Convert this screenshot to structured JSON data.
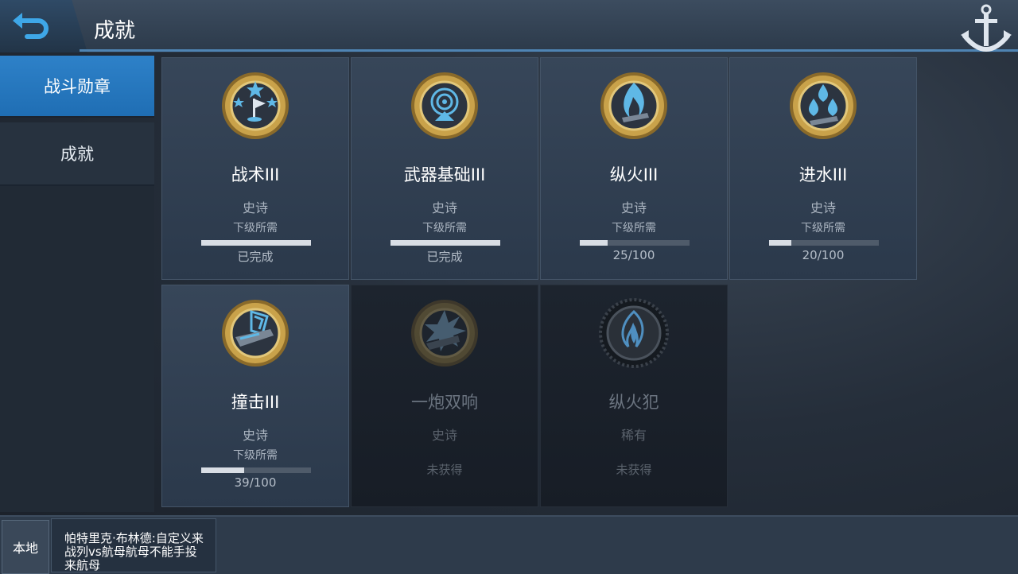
{
  "header": {
    "title": "成就"
  },
  "sidebar": {
    "items": [
      {
        "label": "战斗勋章"
      },
      {
        "label": "成就"
      }
    ]
  },
  "cards": [
    {
      "name": "战术III",
      "rarity": "史诗",
      "requirement": "下级所需",
      "status": "已完成",
      "progress": 1.0,
      "medal_icon": "flag-stars-medal-icon",
      "unlocked": true
    },
    {
      "name": "武器基础III",
      "rarity": "史诗",
      "requirement": "下级所需",
      "status": "已完成",
      "progress": 1.0,
      "medal_icon": "radar-medal-icon",
      "unlocked": true
    },
    {
      "name": "纵火III",
      "rarity": "史诗",
      "requirement": "下级所需",
      "status": "25/100",
      "progress": 0.25,
      "medal_icon": "flame-medal-icon",
      "unlocked": true
    },
    {
      "name": "进水III",
      "rarity": "史诗",
      "requirement": "下级所需",
      "status": "20/100",
      "progress": 0.2,
      "medal_icon": "water-drops-medal-icon",
      "unlocked": true
    },
    {
      "name": "撞击III",
      "rarity": "史诗",
      "requirement": "下级所需",
      "status": "39/100",
      "progress": 0.39,
      "medal_icon": "ram-medal-icon",
      "unlocked": true
    },
    {
      "name": "一炮双响",
      "rarity": "史诗",
      "status": "未获得",
      "medal_icon": "explosion-medal-icon",
      "unlocked": false
    },
    {
      "name": "纵火犯",
      "rarity": "稀有",
      "status": "未获得",
      "medal_icon": "flame-wreath-medal-icon",
      "unlocked": false
    }
  ],
  "chat": {
    "channel": "本地",
    "message": "帕特里克·布林德:自定义来战列vs航母航母不能手投来航母"
  },
  "colors": {
    "accent": "#2e81c8",
    "medal_gold": "#c9a24a",
    "medal_blue": "#5fb8e6"
  }
}
